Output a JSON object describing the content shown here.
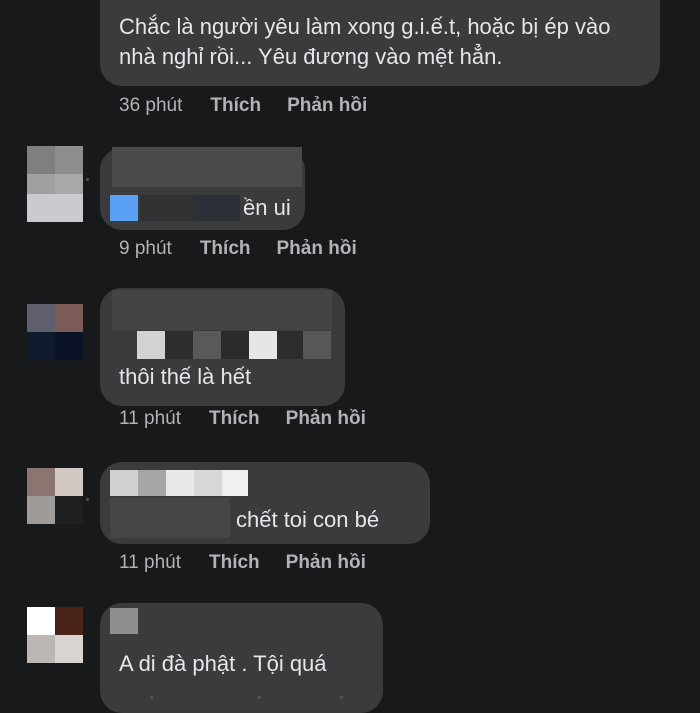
{
  "actions": {
    "like": "Thích",
    "reply": "Phản hồi"
  },
  "comments": [
    {
      "text": "Chắc là người yêu làm xong g.i.ế.t, hoặc bị ép vào nhà nghỉ rồi... Yêu đương vào mệt hẳn.",
      "time": "36 phút"
    },
    {
      "text": "ền ui",
      "time": "9 phút"
    },
    {
      "text": "thôi thế là hết",
      "time": "11 phút"
    },
    {
      "text": "chết toi con bé",
      "time": "11 phút"
    },
    {
      "text": "A di đà phật . Tội quá",
      "time": ""
    }
  ],
  "colors": {
    "background": "#18191a",
    "bubble": "#3a3b3c",
    "text": "#e4e6eb",
    "meta": "#b0b3b8"
  }
}
